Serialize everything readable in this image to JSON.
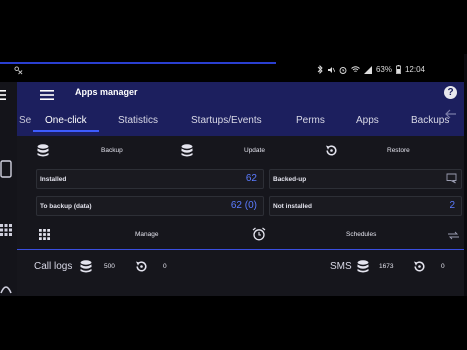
{
  "status_bar": {
    "battery": "63%",
    "time": "12:04"
  },
  "app_bar": {
    "title": "Apps manager",
    "help_symbol": "?",
    "left_tab_fragment": "Se",
    "left_dots": "⋮"
  },
  "tabs": [
    {
      "label": "One-click",
      "active": true
    },
    {
      "label": "Statistics",
      "active": false
    },
    {
      "label": "Startups/Events",
      "active": false
    },
    {
      "label": "Perms",
      "active": false
    },
    {
      "label": "Apps",
      "active": false
    },
    {
      "label": "Backups",
      "active": false
    }
  ],
  "actions_top": {
    "backup": "Backup",
    "update": "Update",
    "restore": "Restore"
  },
  "stats": {
    "installed_label": "Installed",
    "installed_value": "62",
    "backedup_label": "Backed-up",
    "to_backup_label": "To backup (data)",
    "to_backup_value": "62 (0)",
    "not_installed_label": "Not installed",
    "not_installed_value": "2"
  },
  "actions_bottom": {
    "manage": "Manage",
    "schedules": "Schedules"
  },
  "summary": {
    "call_logs_label": "Call logs",
    "call_logs_count": "500",
    "call_logs_restore": "0",
    "sms_label": "SMS",
    "sms_count": "1673",
    "sms_restore": "0"
  },
  "colors": {
    "app_bar": "#1c1f5e",
    "accent": "#3d5cff",
    "value_text": "#5b7bff",
    "background": "#16161c"
  }
}
